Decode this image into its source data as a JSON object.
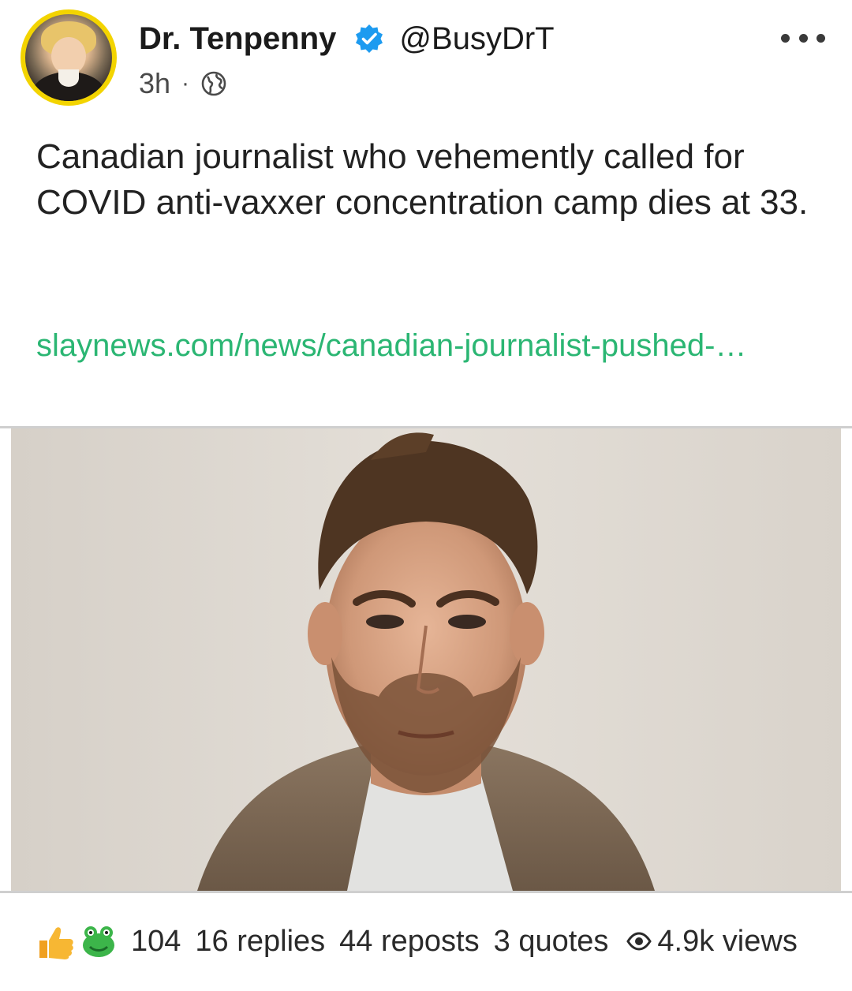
{
  "author": {
    "display_name": "Dr. Tenpenny",
    "handle": "@BusyDrT",
    "verified": true,
    "avatar_ring_color": "#f3d400"
  },
  "meta": {
    "time": "3h",
    "separator": "·",
    "visibility_icon": "globe-icon"
  },
  "post": {
    "text": "Canadian journalist who vehemently called for COVID anti-vaxxer concentration camp dies at 33.",
    "link_text": "slaynews.com/news/canadian-journalist-pushed-…",
    "link_color": "#2bb673"
  },
  "media": {
    "type": "photo",
    "subject": "portrait"
  },
  "stats": {
    "reaction_icons": [
      "thumbs-up-icon",
      "frog-emoji-icon"
    ],
    "reactions": "104",
    "replies": "16 replies",
    "reposts": "44 reposts",
    "quotes": "3 quotes",
    "views": "4.9k views"
  },
  "colors": {
    "verified_badge": "#1d9bf0",
    "text": "#222222",
    "muted": "#4a4a4a"
  }
}
